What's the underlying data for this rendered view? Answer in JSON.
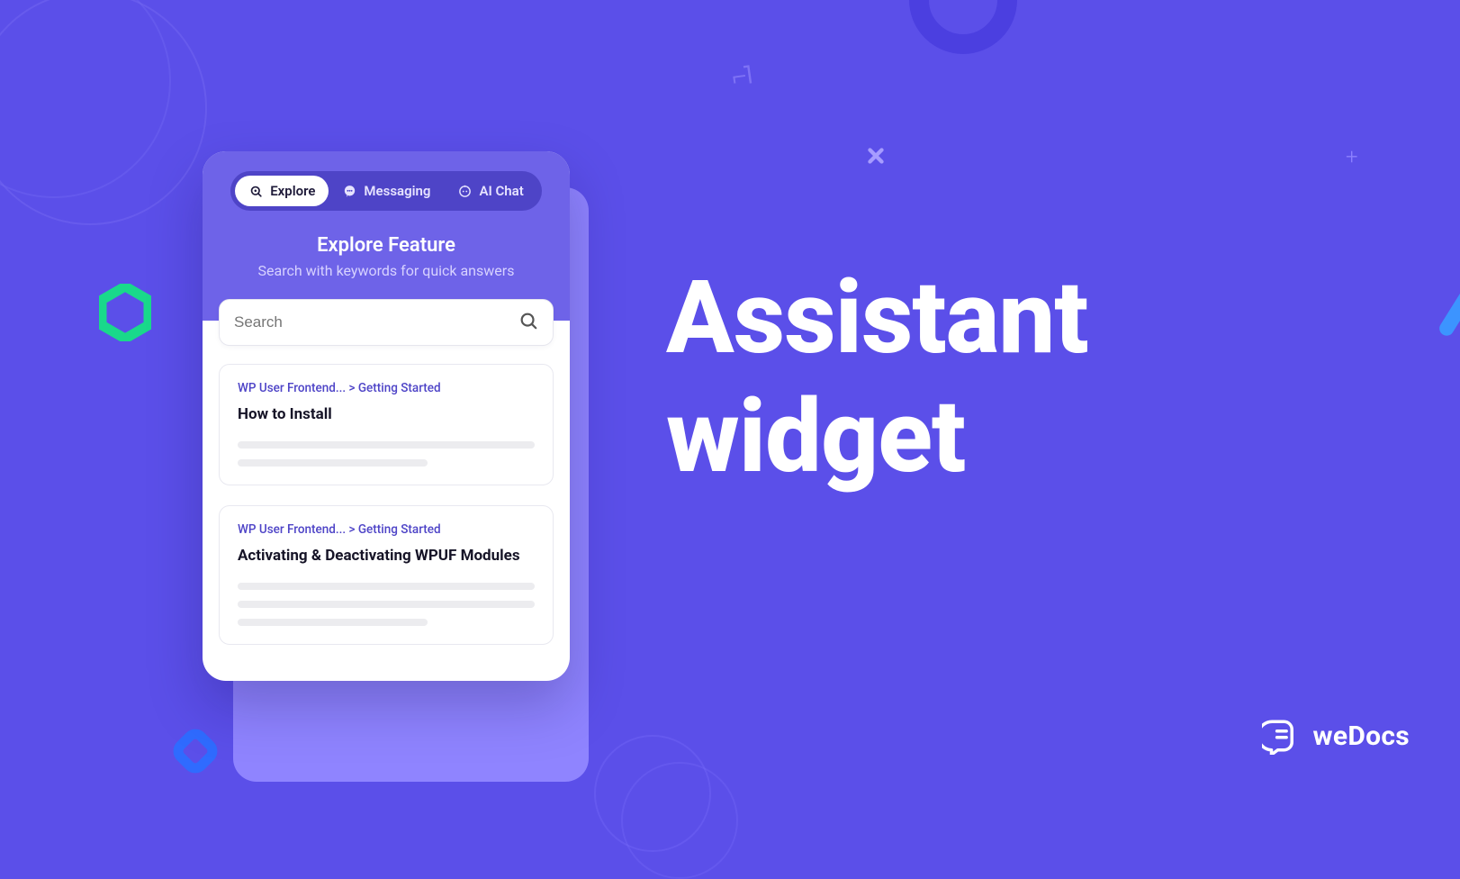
{
  "headline": {
    "line1": "Assistant",
    "line2": "widget"
  },
  "brand": {
    "name": "weDocs"
  },
  "widget": {
    "tabs": [
      {
        "label": "Explore",
        "icon": "explore-icon",
        "active": true
      },
      {
        "label": "Messaging",
        "icon": "messaging-icon",
        "active": false
      },
      {
        "label": "AI Chat",
        "icon": "ai-chat-icon",
        "active": false
      }
    ],
    "title": "Explore Feature",
    "subtitle": "Search with keywords for quick answers",
    "search": {
      "placeholder": "Search"
    },
    "results": [
      {
        "breadcrumb": "WP User Frontend... > Getting Started",
        "title": "How to Install"
      },
      {
        "breadcrumb": "WP User Frontend... > Getting Started",
        "title": "Activating & Deactivating WPUF Modules"
      }
    ]
  }
}
